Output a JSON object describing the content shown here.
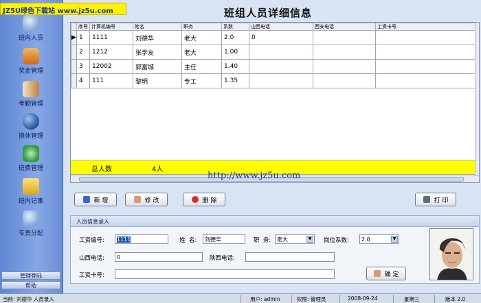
{
  "watermark": "JZ5U绿色下载站 www.jz5u.com",
  "url_overlay": "http://www.jz5u.com",
  "title": "班组人员详细信息",
  "sidebar": {
    "items": [
      {
        "label": "班内人员",
        "icon": "people-icon",
        "color": "#7fa7d8"
      },
      {
        "label": "奖金管理",
        "icon": "money-box-icon",
        "color": "#d88a2a"
      },
      {
        "label": "考勤管理",
        "icon": "notebook-icon",
        "color": "#c08040"
      },
      {
        "label": "换休管理",
        "icon": "globe-icon",
        "color": "#2b5fb0"
      },
      {
        "label": "班费管理",
        "icon": "recycle-icon",
        "color": "#2e9a3a"
      },
      {
        "label": "班内记事",
        "icon": "folder-icon",
        "color": "#e8c040"
      },
      {
        "label": "专责分配",
        "icon": "people-icon",
        "color": "#7fa7d8"
      }
    ],
    "footer": [
      "管理登陆",
      "帮助"
    ]
  },
  "grid": {
    "columns": [
      "序号",
      "计算机编号",
      "姓名",
      "职务",
      "系数",
      "山西电话",
      "西安电话",
      "工资卡号"
    ],
    "rows": [
      [
        "1",
        "1111",
        "刘德华",
        "老大",
        "2.0",
        "0",
        "",
        ""
      ],
      [
        "2",
        "1212",
        "张学友",
        "老大",
        "1.00",
        "",
        "",
        ""
      ],
      [
        "3",
        "12002",
        "郭富城",
        "主任",
        "1.40",
        "",
        "",
        ""
      ],
      [
        "4",
        "111",
        "黎明",
        "专工",
        "1.35",
        "",
        "",
        ""
      ]
    ],
    "total_label": "总人数",
    "total_value": "4人"
  },
  "buttons": {
    "add": "新 增",
    "edit": "修 改",
    "delete": "删 除",
    "print": "打 印",
    "confirm": "确 定"
  },
  "form": {
    "title": "人员信息录入",
    "salary_no_label": "工资编号:",
    "salary_no_value": "1111",
    "name_label": "姓  名:",
    "name_value": "刘德华",
    "duty_label": "职  务:",
    "duty_value": "老大",
    "coef_label": "岗位系数:",
    "coef_value": "2.0",
    "sx_phone_label": "山西电话:",
    "sx_phone_value": "0",
    "sxi_phone_label": "陕西电话:",
    "sxi_phone_value": "",
    "card_label": "工资卡号:",
    "card_value": ""
  },
  "status": {
    "left": "当前: 刘德华  人员录入",
    "user": "用户: admin",
    "rights": "权限: 管理员",
    "date": "2008-09-24",
    "weekday": "星期三",
    "version": "版本 2.0"
  }
}
